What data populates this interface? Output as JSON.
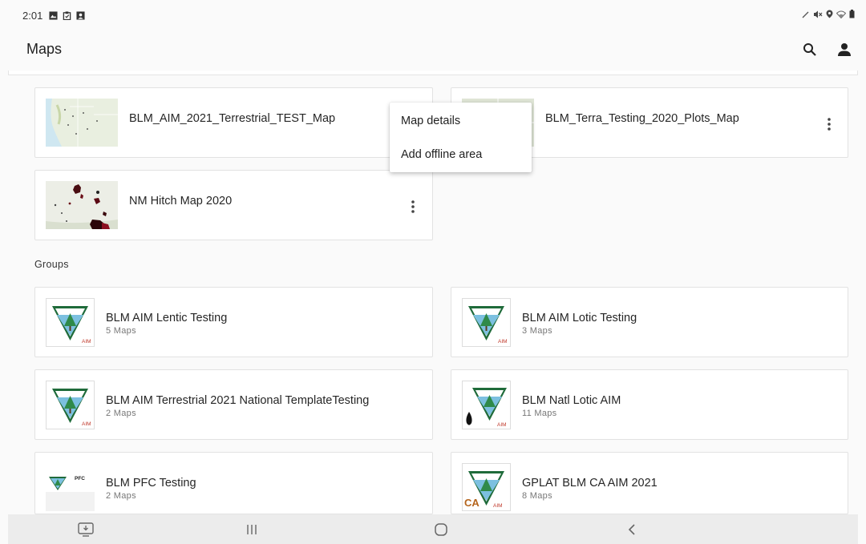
{
  "status_bar": {
    "time": "2:01"
  },
  "app_bar": {
    "title": "Maps"
  },
  "maps": [
    {
      "title": "BLM_AIM_2021_Terrestrial_TEST_Map"
    },
    {
      "title": "BLM_Terra_Testing_2020_Plots_Map"
    },
    {
      "title": "NM Hitch Map 2020"
    }
  ],
  "context_menu": {
    "items": [
      {
        "label": "Map details"
      },
      {
        "label": "Add offline area"
      }
    ]
  },
  "groups_section": {
    "label": "Groups"
  },
  "groups": [
    {
      "title": "BLM AIM Lentic Testing",
      "count": "5 Maps",
      "badge": "AIM"
    },
    {
      "title": "BLM AIM Lotic Testing",
      "count": "3 Maps",
      "badge": "AIM"
    },
    {
      "title": "BLM AIM Terrestrial 2021 National TemplateTesting",
      "count": "2 Maps",
      "badge": "AIM"
    },
    {
      "title": "BLM Natl Lotic AIM",
      "count": "11 Maps",
      "badge": "AIM"
    },
    {
      "title": "BLM PFC Testing",
      "count": "2 Maps",
      "badge": "PFC"
    },
    {
      "title": "GPLAT BLM CA AIM 2021",
      "count": "8 Maps",
      "badge": "AIM",
      "badge_prefix": "CA"
    }
  ],
  "colors": {
    "badge_green": "#1f6b3a",
    "badge_red": "#c0392b",
    "ca_orange": "#b5651d"
  }
}
